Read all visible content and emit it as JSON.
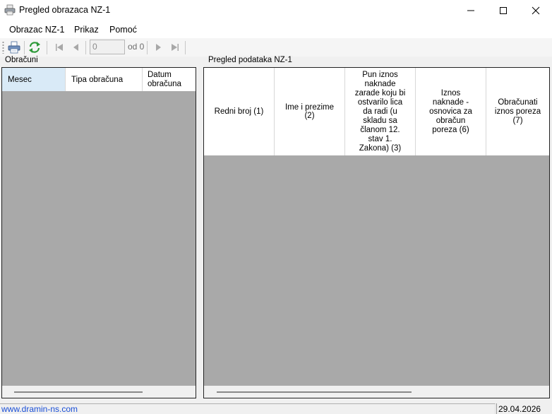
{
  "window": {
    "title": "Pregled obrazaca NZ-1",
    "controls": {
      "minimize": "minimize-icon",
      "maximize": "maximize-icon",
      "close": "close-icon"
    }
  },
  "menu": {
    "items": [
      "Obrazac NZ-1",
      "Prikaz",
      "Pomoć"
    ]
  },
  "toolbar": {
    "icons": [
      "print-icon",
      "refresh-icon",
      "first-page-icon",
      "previous-page-icon",
      "next-page-icon",
      "last-page-icon"
    ],
    "page_value": "0",
    "of_label": "od 0"
  },
  "left_panel": {
    "label": "Obračuni",
    "columns": [
      "Mesec",
      "Tipa obračuna",
      "Datum obračuna"
    ],
    "selected_column": "Mesec",
    "rows": []
  },
  "right_panel": {
    "label": "Pregled podataka NZ-1",
    "columns": [
      "Redni broj (1)",
      "Ime i prezime (2)",
      "Pun iznos naknade zarade koju bi ostvarilo lica da radi (u skladu sa članom 12. stav 1. Zakona) (3)",
      "Iznos naknade - osnovica za obračun poreza (6)",
      "Obračunati iznos poreza (7)"
    ],
    "rows": []
  },
  "status": {
    "website": "www.dramin-ns.com",
    "date": "29.04.2026"
  },
  "colors": {
    "grid_background": "#a9a9a9",
    "selected_header": "#d9eaf7",
    "link": "#1a4fd6"
  }
}
